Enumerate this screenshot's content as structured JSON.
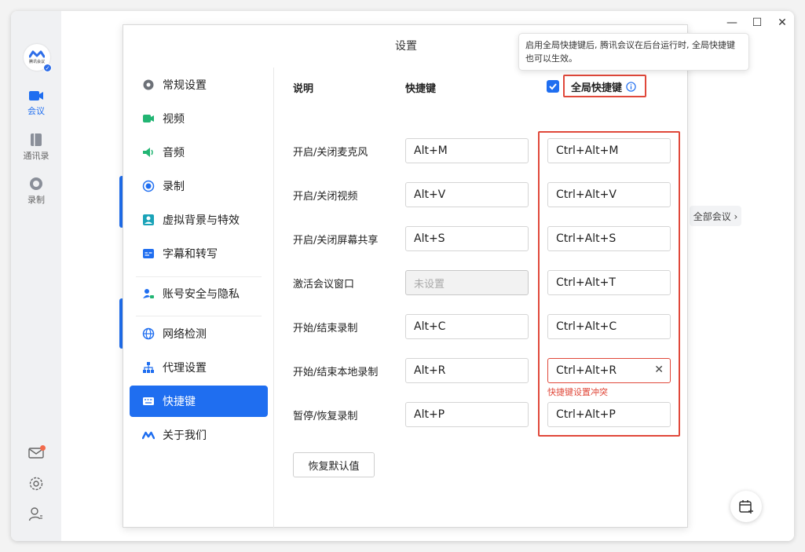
{
  "app": {
    "logo_text": "腾讯会议",
    "rail": [
      {
        "label": "会议",
        "icon": "video-camera-icon",
        "active": true
      },
      {
        "label": "通讯录",
        "icon": "contacts-book-icon",
        "active": false
      },
      {
        "label": "录制",
        "icon": "record-icon",
        "active": false
      }
    ],
    "all_meetings": "全部会议 ›"
  },
  "dialog": {
    "title": "设置",
    "nav": [
      {
        "label": "常规设置",
        "icon": "gear-icon"
      },
      {
        "label": "视频",
        "icon": "video-icon"
      },
      {
        "label": "音频",
        "icon": "speaker-icon"
      },
      {
        "label": "录制",
        "icon": "record-icon"
      },
      {
        "label": "虚拟背景与特效",
        "icon": "portrait-icon"
      },
      {
        "label": "字幕和转写",
        "icon": "subtitle-icon"
      },
      {
        "label": "账号安全与隐私",
        "icon": "account-lock-icon"
      },
      {
        "label": "网络检测",
        "icon": "globe-icon"
      },
      {
        "label": "代理设置",
        "icon": "network-tree-icon"
      },
      {
        "label": "快捷键",
        "icon": "keyboard-icon",
        "active": true
      },
      {
        "label": "关于我们",
        "icon": "tencent-meeting-logo-icon"
      }
    ],
    "shortcuts": {
      "header_desc": "说明",
      "header_key": "快捷键",
      "header_global": "全局快捷键",
      "global_enabled": true,
      "tooltip": "启用全局快捷键后, 腾讯会议在后台运行时, 全局快捷键也可以生效。",
      "rows": [
        {
          "label": "开启/关闭麦克风",
          "key": "Alt+M",
          "global": "Ctrl+Alt+M"
        },
        {
          "label": "开启/关闭视频",
          "key": "Alt+V",
          "global": "Ctrl+Alt+V"
        },
        {
          "label": "开启/关闭屏幕共享",
          "key": "Alt+S",
          "global": "Ctrl+Alt+S"
        },
        {
          "label": "激活会议窗口",
          "key": "未设置",
          "global": "Ctrl+Alt+T"
        },
        {
          "label": "开始/结束录制",
          "key": "Alt+C",
          "global": "Ctrl+Alt+C"
        },
        {
          "label": "开始/结束本地录制",
          "key": "Alt+R",
          "global": "Ctrl+Alt+R"
        },
        {
          "label": "暂停/恢复录制",
          "key": "Alt+P",
          "global": "Ctrl+Alt+P"
        }
      ],
      "conflict_error": "快捷键设置冲突",
      "restore_label": "恢复默认值"
    }
  },
  "colors": {
    "accent": "#1f6ef0",
    "error": "#e0483a"
  }
}
